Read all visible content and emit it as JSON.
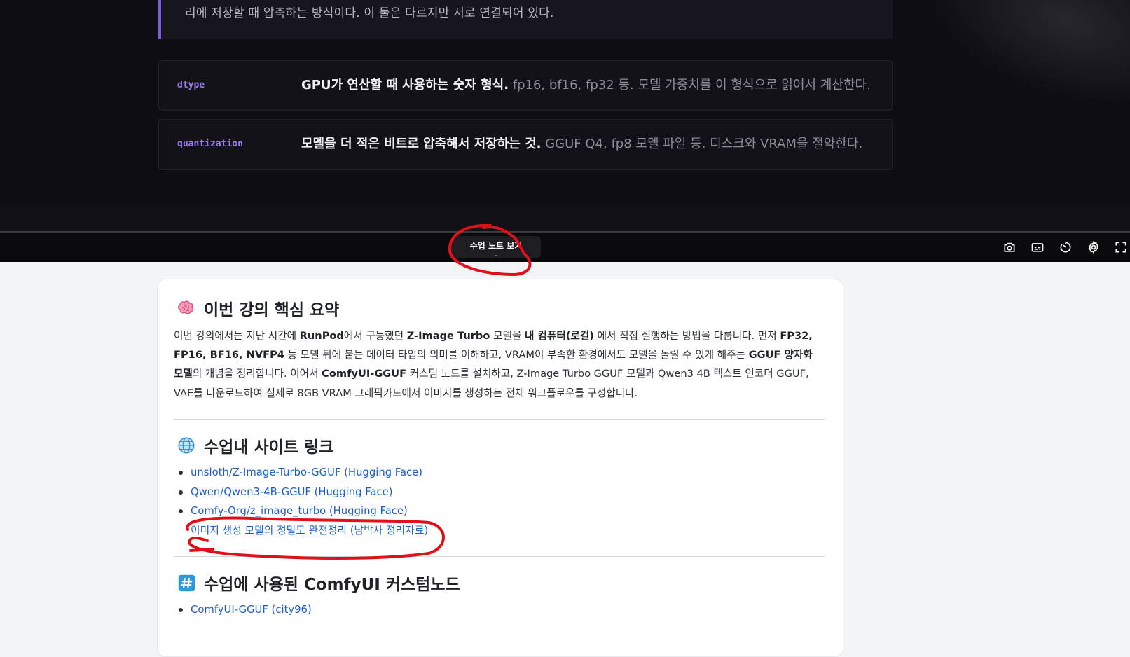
{
  "video": {
    "quote_text": "리에 저장할 때 압축하는 방식이다. 이 둘은 다르지만 서로 연결되어 있다.",
    "terms": [
      {
        "key": "dtype",
        "bold": "GPU가 연산할 때 사용하는 숫자 형식.",
        "rest": " fp16, bf16, fp32 등. 모델 가중치를 이 형식으로 읽어서 계산한다."
      },
      {
        "key": "quantization",
        "bold": "모델을 더 적은 비트로 압축해서 저장하는 것.",
        "rest": " GGUF Q4, fp8 모델 파일 등. 디스크와 VRAM을 절약한다."
      }
    ]
  },
  "controls": {
    "notes_toggle_label": "수업 노트 보기",
    "notes_toggle_chevron": "⌄",
    "icons": [
      "camera-icon",
      "subtitles-icon",
      "timer-icon",
      "settings-icon",
      "fullscreen-icon"
    ]
  },
  "notes": {
    "summary": {
      "emoji": "🧠",
      "title": "이번 강의 핵심 요약",
      "p1": "이번 강의에서는 지난 시간에 ",
      "b1": "RunPod",
      "p2": "에서 구동했던 ",
      "b2": "Z-Image Turbo",
      "p3": " 모델을 ",
      "b3": "내 컴퓨터(로컬)",
      "p4": " 에서 직접 실행하는 방법을 다룹니다. 먼저 ",
      "b4": "FP32, FP16, BF16, NVFP4",
      "p5": " 등 모델 뒤에 붙는 데이터 타입의 의미를 이해하고, VRAM이 부족한 환경에서도 모델을 돌릴 수 있게 해주는 ",
      "b5": "GGUF 양자화 모델",
      "p6": "의 개념을 정리합니다. 이어서 ",
      "b6": "ComfyUI-GGUF",
      "p7": " 커스텀 노드를 설치하고, Z-Image Turbo GGUF 모델과 Qwen3 4B 텍스트 인코더 GGUF, VAE를 다운로드하여 실제로 8GB VRAM 그래픽카드에서 이미지를 생성하는 전체 워크플로우를 구성합니다."
    },
    "links": {
      "emoji": "🌐",
      "title": "수업내 사이트 링크",
      "items": [
        "unsloth/Z-Image-Turbo-GGUF (Hugging Face)",
        "Qwen/Qwen3-4B-GGUF (Hugging Face)",
        "Comfy-Org/z_image_turbo (Hugging Face)",
        "이미지 생성 모델의 정밀도 완전정리 (남박사 정리자료)"
      ]
    },
    "nodes": {
      "emoji": "#️⃣",
      "title": "수업에 사용된 ComfyUI 커스텀노드",
      "items": [
        "ComfyUI-GGUF (city96)"
      ]
    }
  },
  "colors": {
    "accent_purple": "#9b7cf0",
    "link_blue": "#1a5fc9",
    "annotation_red": "#e0101a"
  }
}
